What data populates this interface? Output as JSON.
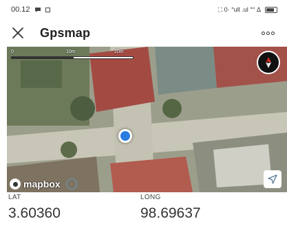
{
  "status_bar": {
    "time": "00.12",
    "right_text": "⛶ 0· °ull .ul °° Δ"
  },
  "app_bar": {
    "title": "Gpsmap"
  },
  "map": {
    "scale_labels": [
      "0",
      "10m",
      "20m"
    ],
    "attribution": "mapbox"
  },
  "coordinates": {
    "lat_label": "LAT",
    "lat_value": "3.60360",
    "long_label": "LONG",
    "long_value": "98.69637"
  },
  "icons": {
    "close": "close-icon",
    "more": "more-options-icon",
    "compass": "compass-icon",
    "locate": "navigation-arrow-icon",
    "mapbox": "mapbox-logo-icon",
    "info": "info-circle-icon"
  },
  "colors": {
    "location_dot": "#2b7de1",
    "compass_needle": "#e53935"
  }
}
